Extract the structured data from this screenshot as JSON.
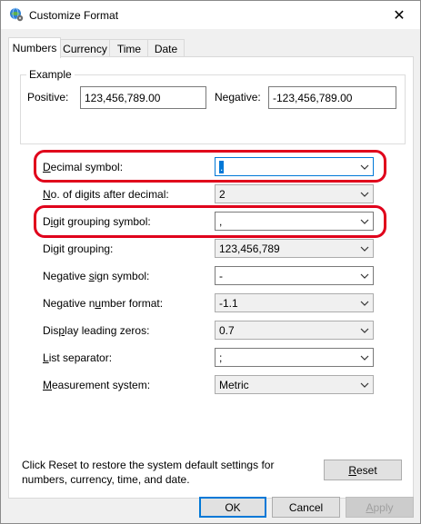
{
  "window": {
    "title": "Customize Format",
    "close_symbol": "✕"
  },
  "tabs": [
    {
      "label": "Numbers"
    },
    {
      "label": "Currency"
    },
    {
      "label": "Time"
    },
    {
      "label": "Date"
    }
  ],
  "example": {
    "legend": "Example",
    "positive_label": "Positive:",
    "positive_value": "123,456,789.00",
    "negative_label": "Negative:",
    "negative_value": "-123,456,789.00"
  },
  "settings": {
    "decimal_symbol": {
      "label_u": "D",
      "label_rest": "ecimal symbol:",
      "value": "."
    },
    "digits_after_decimal": {
      "label_u": "N",
      "label_rest": "o. of digits after decimal:",
      "value": "2"
    },
    "digit_grouping_symbol": {
      "label_pre": "D",
      "label_u": "i",
      "label_rest": "git grouping symbol:",
      "value": ","
    },
    "digit_grouping": {
      "label": "Digit grouping:",
      "value": "123,456,789"
    },
    "negative_sign_symbol": {
      "label_pre": "Negative ",
      "label_u": "s",
      "label_rest": "ign symbol:",
      "value": "-"
    },
    "negative_number_format": {
      "label_pre": "Negative n",
      "label_u": "u",
      "label_rest": "mber format:",
      "value": "-1.1"
    },
    "display_leading_zeros": {
      "label_pre": "Dis",
      "label_u": "p",
      "label_rest": "lay leading zeros:",
      "value": "0.7"
    },
    "list_separator": {
      "label_u": "L",
      "label_rest": "ist separator:",
      "value": ";"
    },
    "measurement_system": {
      "label_pre": "",
      "label_u": "M",
      "label_rest": "easurement system:",
      "value": "Metric"
    }
  },
  "footer": {
    "info": "Click Reset to restore the system default settings for numbers, currency, time, and date.",
    "reset_pre": "",
    "reset_u": "R",
    "reset_rest": "eset"
  },
  "buttons": {
    "ok": "OK",
    "cancel": "Cancel",
    "apply_u": "A",
    "apply_rest": "pply"
  },
  "colors": {
    "annotation_red": "#e0001b",
    "focus_blue": "#0078d7"
  }
}
